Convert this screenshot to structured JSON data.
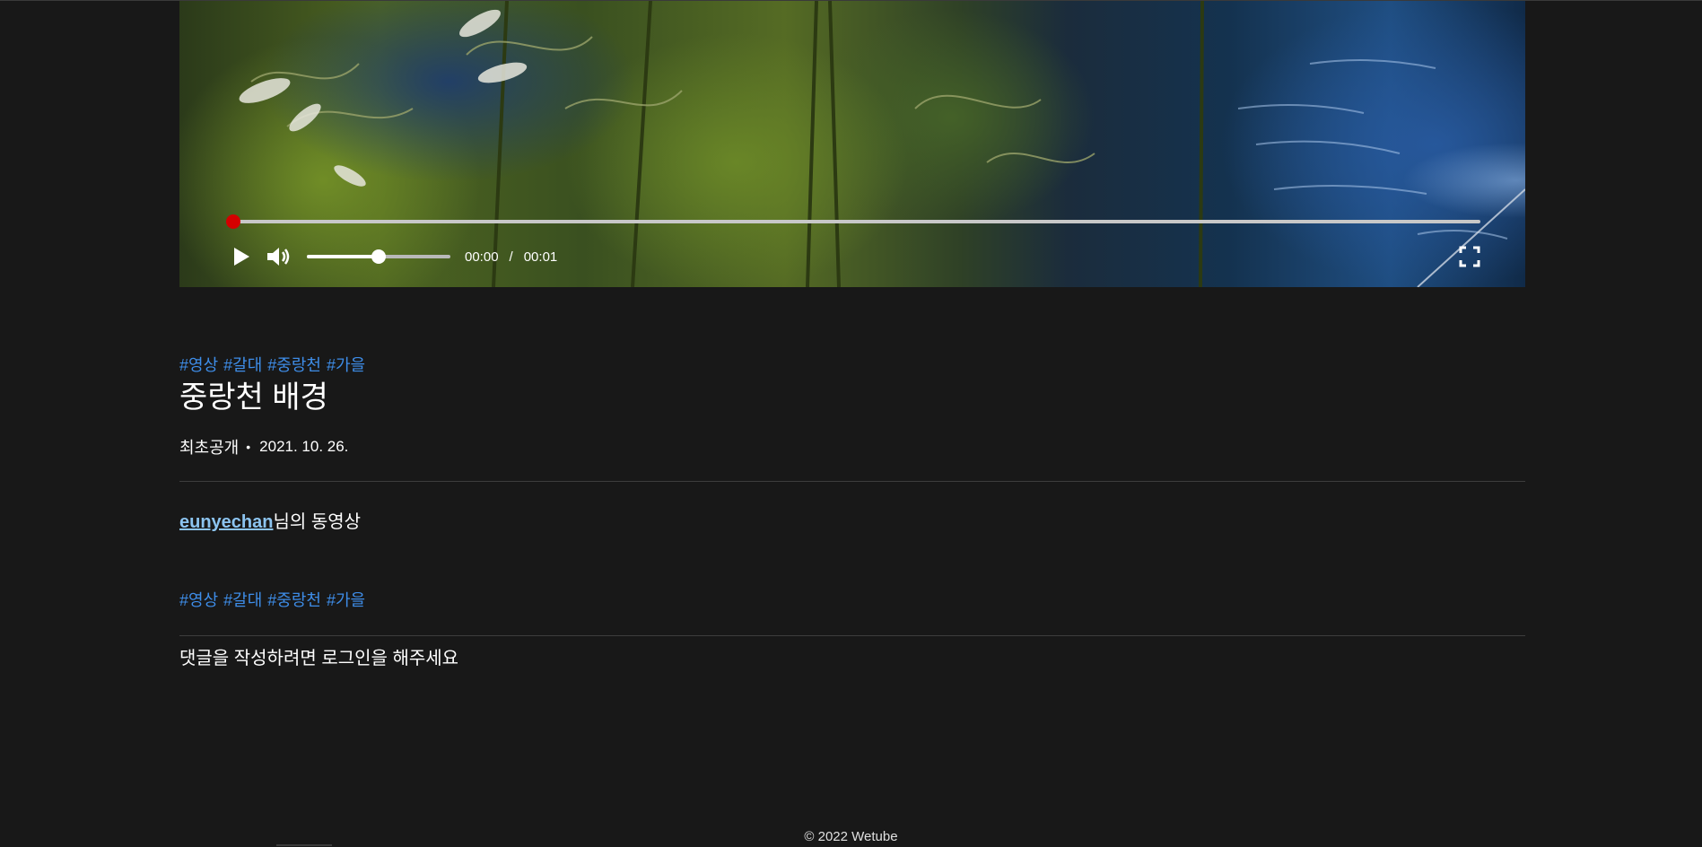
{
  "video": {
    "current_time": "00:00",
    "time_separator": "/",
    "duration": "00:01",
    "progress_fraction": 0.0,
    "volume_fraction": 0.5,
    "accent_color": "#d40000"
  },
  "tags": [
    "#영상",
    "#갈대",
    "#중랑천",
    "#가을"
  ],
  "title": "중랑천 배경",
  "meta": {
    "label": "최초공개",
    "dot": "•",
    "date": "2021. 10. 26."
  },
  "owner": {
    "username": "eunyechan",
    "suffix": "님의 동영상"
  },
  "comments": {
    "login_message": "댓글을 작성하려면 로그인을 해주세요"
  },
  "footer": {
    "copyright": "© 2022 Wetube"
  },
  "icons": {
    "play": "play-icon",
    "volume": "volume-icon",
    "fullscreen": "fullscreen-icon"
  }
}
